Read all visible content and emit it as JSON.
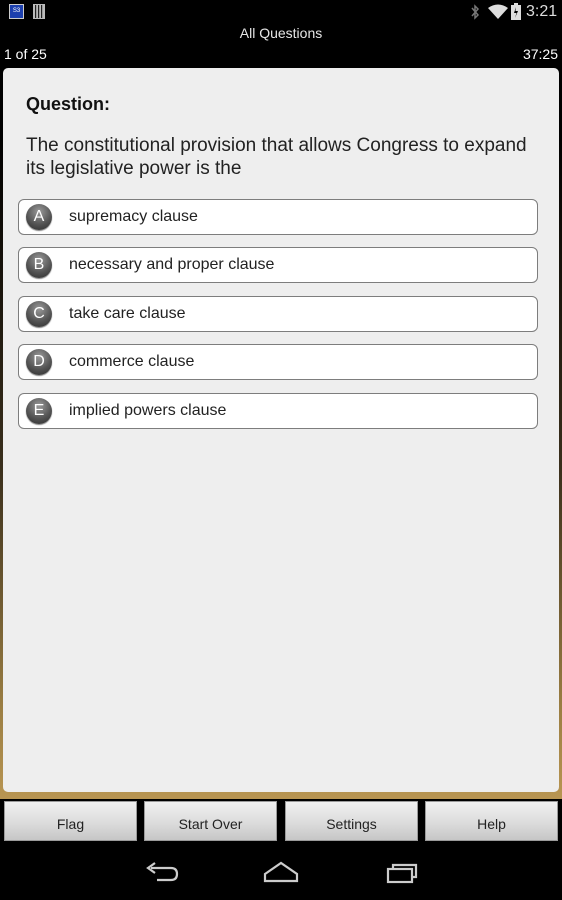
{
  "status_bar": {
    "time": "3:21",
    "notification_icons": [
      "app-notification-icon",
      "sd-card-icon"
    ],
    "system_icons": [
      "bluetooth-icon",
      "wifi-icon",
      "battery-icon"
    ]
  },
  "header": {
    "title": "All Questions",
    "progress": "1 of 25",
    "timer": "37:25"
  },
  "question": {
    "heading": "Question:",
    "text": "The constitutional provision that allows Congress to expand its legislative power is the"
  },
  "options": [
    {
      "letter": "A",
      "label": "supremacy clause"
    },
    {
      "letter": "B",
      "label": "necessary and proper clause"
    },
    {
      "letter": "C",
      "label": "take care clause"
    },
    {
      "letter": "D",
      "label": "commerce clause"
    },
    {
      "letter": "E",
      "label": "implied powers clause"
    }
  ],
  "buttons": {
    "flag": "Flag",
    "start_over": "Start Over",
    "settings": "Settings",
    "help": "Help"
  },
  "nav_bar": {
    "icons": [
      "back-icon",
      "home-icon",
      "recent-apps-icon"
    ]
  },
  "colors": {
    "card_background": "#eeeeee",
    "option_border": "#7d7d7d",
    "badge": "#555555",
    "bottom_gradient": "#b89552"
  }
}
